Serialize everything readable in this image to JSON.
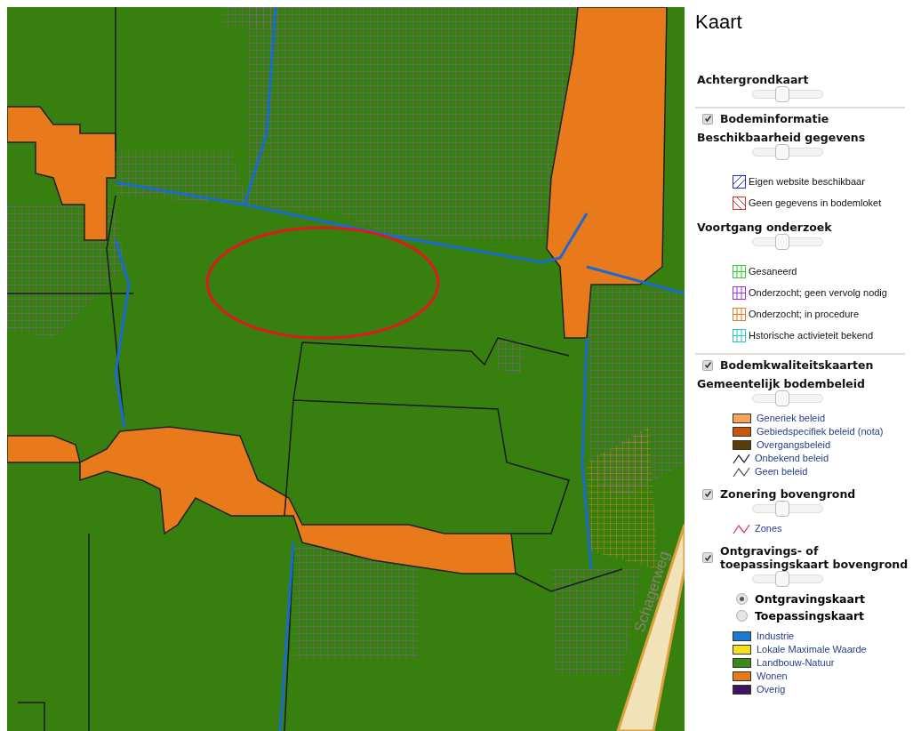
{
  "map": {
    "road_label": "Schagerweg"
  },
  "sidebar": {
    "title": "Kaart",
    "blocks": [
      {
        "kind": "group",
        "title": "Achtergrondkaart",
        "level": 0.4
      },
      {
        "kind": "divider"
      },
      {
        "kind": "layer",
        "title": "Bodeminformatie",
        "checked": true
      },
      {
        "kind": "group",
        "title": "Beschikbaarheid gegevens",
        "level": 0.4,
        "legend": [
          {
            "kind": "hatch-up",
            "color": "#1f2fd6",
            "label": "Eigen website beschikbaar"
          },
          {
            "kind": "hatch-down",
            "color": "#e02b2b",
            "label": "Geen gegevens in bodemloket"
          }
        ]
      },
      {
        "kind": "group",
        "title": "Voortgang onderzoek",
        "level": 0.4,
        "legend": [
          {
            "kind": "grid",
            "color": "#2ecc2e",
            "label": "Gesaneerd"
          },
          {
            "kind": "grid",
            "color": "#9b30e0",
            "label": "Onderzocht; geen vervolg nodig"
          },
          {
            "kind": "grid",
            "color": "#e07a20",
            "label": "Onderzocht; in procedure"
          },
          {
            "kind": "grid",
            "color": "#20c8c8",
            "label": "Hstorische activieteit bekend"
          }
        ]
      },
      {
        "kind": "divider"
      },
      {
        "kind": "layer",
        "title": "Bodemkwaliteitskaarten",
        "checked": true
      },
      {
        "kind": "group",
        "title": "Gemeentelijk bodembeleid",
        "level": 0.4,
        "legend": [
          {
            "kind": "swatch",
            "color": "#f5a55a",
            "label": "Generiek beleid"
          },
          {
            "kind": "swatch",
            "color": "#c8550a",
            "label": "Gebiedspecifiek beleid (nota)"
          },
          {
            "kind": "swatch",
            "color": "#5c3c08",
            "label": "Overgangsbeleid"
          },
          {
            "kind": "line",
            "color": "#1c1c3c",
            "label": "Onbekend beleid"
          },
          {
            "kind": "line",
            "color": "#555555",
            "label": "Geen beleid"
          }
        ]
      },
      {
        "kind": "layer",
        "title": "Zonering bovengrond",
        "checked": true,
        "level": 0.4,
        "legend": [
          {
            "kind": "line",
            "color": "#e0306a",
            "label": "Zones"
          }
        ]
      },
      {
        "kind": "layer",
        "title": "Ontgravings- of toepassingskaart bovengrond",
        "checked": true,
        "level": 0.4,
        "options": [
          {
            "label": "Ontgravingskaart",
            "selected": true
          },
          {
            "label": "Toepassingskaart",
            "selected": false
          }
        ],
        "legend": [
          {
            "kind": "swatch",
            "color": "#1a7ad0",
            "label": "Industrie"
          },
          {
            "kind": "swatch",
            "color": "#f5e020",
            "label": "Lokale Maximale Waarde"
          },
          {
            "kind": "swatch",
            "color": "#3a8a1a",
            "label": "Landbouw-Natuur"
          },
          {
            "kind": "swatch",
            "color": "#e8761a",
            "label": "Wonen"
          },
          {
            "kind": "swatch",
            "color": "#3c1460",
            "label": "Overig"
          }
        ]
      }
    ]
  }
}
